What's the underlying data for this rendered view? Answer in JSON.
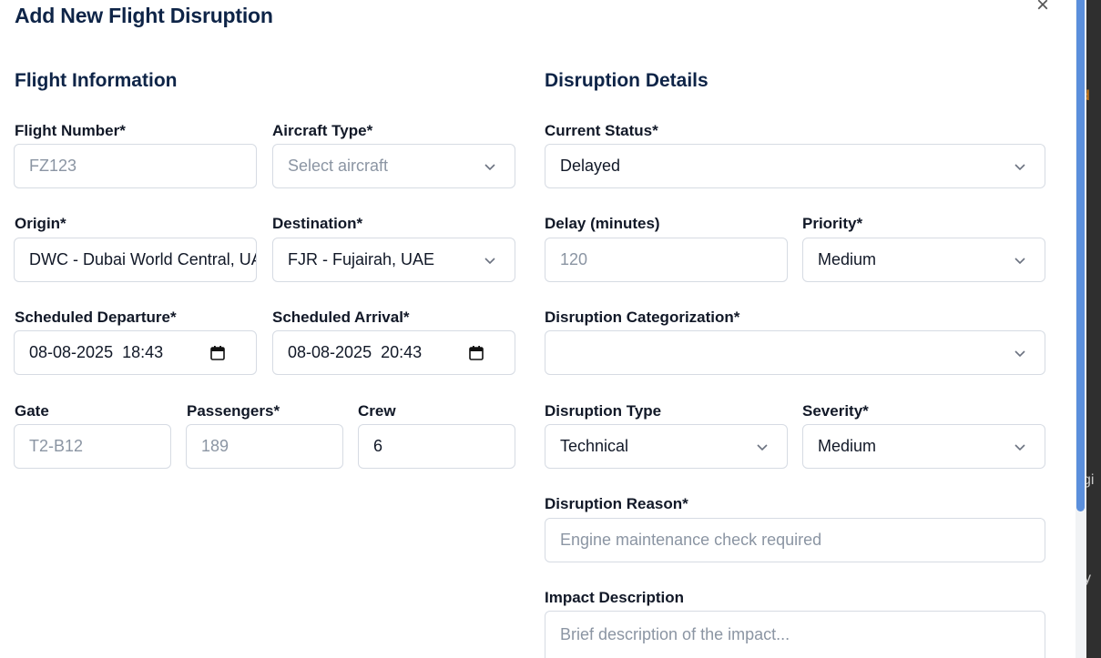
{
  "modal": {
    "title": "Add New Flight Disruption",
    "close_glyph": "×"
  },
  "flight_info": {
    "heading": "Flight Information",
    "flight_number": {
      "label": "Flight Number*",
      "placeholder": "FZ123"
    },
    "aircraft_type": {
      "label": "Aircraft Type*",
      "placeholder": "Select aircraft"
    },
    "origin": {
      "label": "Origin*",
      "value": "DWC - Dubai World Central, UAE"
    },
    "destination": {
      "label": "Destination*",
      "value": "FJR - Fujairah, UAE"
    },
    "scheduled_departure": {
      "label": "Scheduled Departure*",
      "value": "08-08-2025  18:43"
    },
    "scheduled_arrival": {
      "label": "Scheduled Arrival*",
      "value": "08-08-2025  20:43"
    },
    "gate": {
      "label": "Gate",
      "placeholder": "T2-B12"
    },
    "passengers": {
      "label": "Passengers*",
      "placeholder": "189"
    },
    "crew": {
      "label": "Crew",
      "value": "6"
    }
  },
  "disruption": {
    "heading": "Disruption Details",
    "current_status": {
      "label": "Current Status*",
      "value": "Delayed"
    },
    "delay_minutes": {
      "label": "Delay (minutes)",
      "placeholder": "120"
    },
    "priority": {
      "label": "Priority*",
      "value": "Medium"
    },
    "categorization": {
      "label": "Disruption Categorization*",
      "value": ""
    },
    "type": {
      "label": "Disruption Type",
      "value": "Technical"
    },
    "severity": {
      "label": "Severity*",
      "value": "Medium"
    },
    "reason": {
      "label": "Disruption Reason*",
      "placeholder": "Engine maintenance check required"
    },
    "impact": {
      "label": "Impact Description",
      "placeholder": "Brief description of the impact..."
    }
  },
  "background_peek": {
    "a": "d",
    "b": "gi",
    "c": "y"
  },
  "icons": {
    "dropdown": "chevron-down-icon",
    "calendar": "calendar-icon",
    "close": "close-icon"
  }
}
